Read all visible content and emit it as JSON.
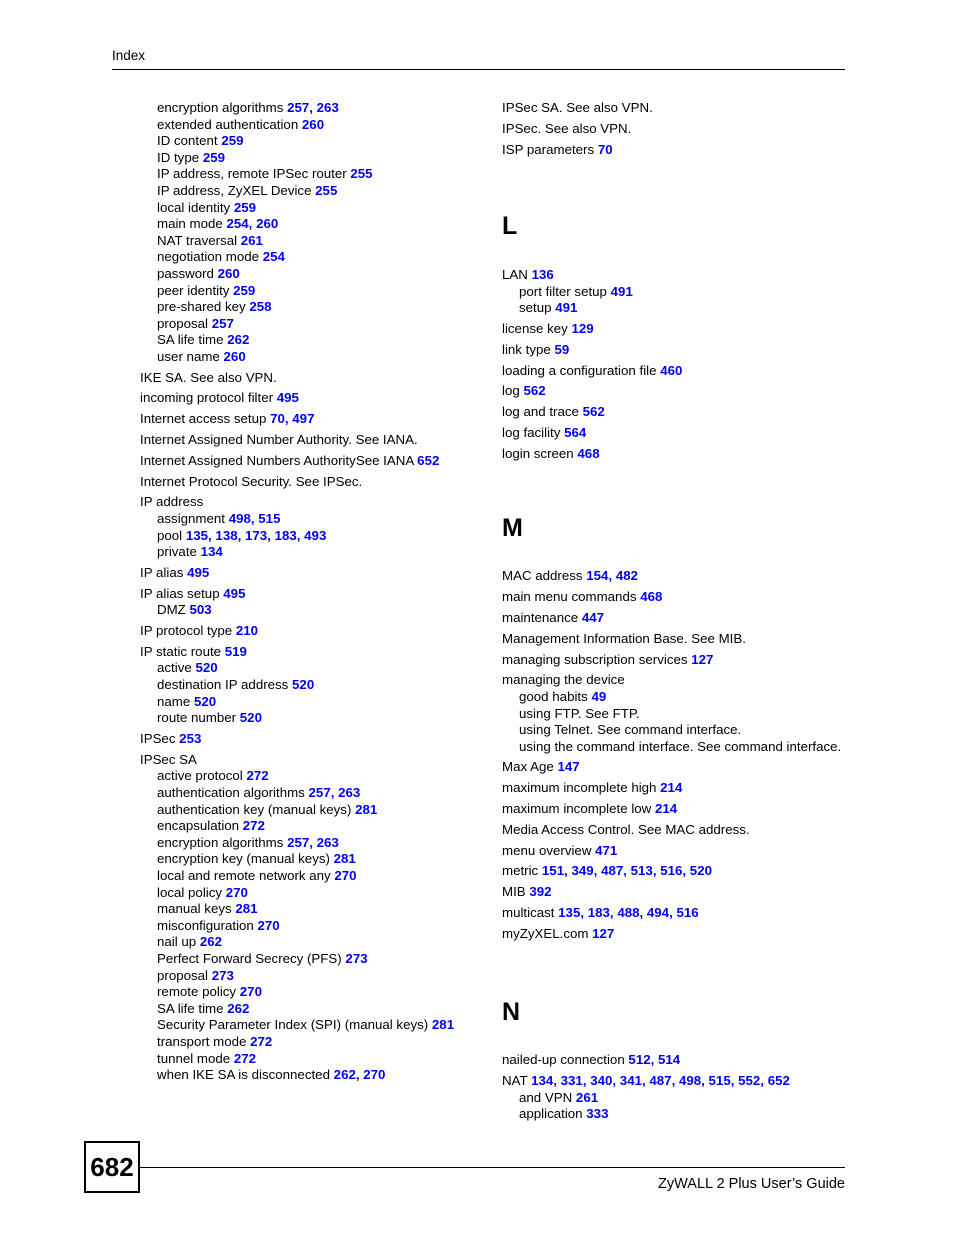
{
  "header": {
    "title": "Index"
  },
  "footer": {
    "page_number": "682",
    "guide_title": "ZyWALL 2 Plus User’s Guide"
  },
  "colors": {
    "page_reference": "#0000F5",
    "text": "#000000",
    "background": "#FFFFFF"
  },
  "left_column": {
    "entries": [
      {
        "level": 1,
        "text": "encryption algorithms ",
        "pages": [
          "257",
          "263"
        ]
      },
      {
        "level": 1,
        "text": "extended authentication ",
        "pages": [
          "260"
        ]
      },
      {
        "level": 1,
        "text": "ID content ",
        "pages": [
          "259"
        ]
      },
      {
        "level": 1,
        "text": "ID type ",
        "pages": [
          "259"
        ]
      },
      {
        "level": 1,
        "text": "IP address, remote IPSec router ",
        "pages": [
          "255"
        ]
      },
      {
        "level": 1,
        "text": "IP address, ZyXEL Device ",
        "pages": [
          "255"
        ]
      },
      {
        "level": 1,
        "text": "local identity ",
        "pages": [
          "259"
        ]
      },
      {
        "level": 1,
        "text": "main mode ",
        "pages": [
          "254",
          "260"
        ]
      },
      {
        "level": 1,
        "text": "NAT traversal ",
        "pages": [
          "261"
        ]
      },
      {
        "level": 1,
        "text": "negotiation mode ",
        "pages": [
          "254"
        ]
      },
      {
        "level": 1,
        "text": "password ",
        "pages": [
          "260"
        ]
      },
      {
        "level": 1,
        "text": "peer identity ",
        "pages": [
          "259"
        ]
      },
      {
        "level": 1,
        "text": "pre-shared key ",
        "pages": [
          "258"
        ]
      },
      {
        "level": 1,
        "text": "proposal ",
        "pages": [
          "257"
        ]
      },
      {
        "level": 1,
        "text": "SA life time ",
        "pages": [
          "262"
        ]
      },
      {
        "level": 1,
        "text": "user name ",
        "pages": [
          "260"
        ]
      },
      {
        "level": 0,
        "text": "IKE SA. See also VPN.",
        "pages": []
      },
      {
        "level": 0,
        "text": "incoming protocol filter ",
        "pages": [
          "495"
        ]
      },
      {
        "level": 0,
        "text": "Internet access setup ",
        "pages": [
          "70",
          "497"
        ]
      },
      {
        "level": 0,
        "text": "Internet Assigned Number Authority. See IANA.",
        "pages": []
      },
      {
        "level": 0,
        "text": "Internet Assigned Numbers AuthoritySee IANA ",
        "pages": [
          "652"
        ]
      },
      {
        "level": 0,
        "text": "Internet Protocol Security. See IPSec.",
        "pages": []
      },
      {
        "level": 0,
        "text": "IP address",
        "pages": []
      },
      {
        "level": 1,
        "text": "assignment ",
        "pages": [
          "498",
          "515"
        ]
      },
      {
        "level": 1,
        "text": "pool ",
        "pages": [
          "135",
          "138",
          "173",
          "183",
          "493"
        ]
      },
      {
        "level": 1,
        "text": "private ",
        "pages": [
          "134"
        ]
      },
      {
        "level": 0,
        "text": "IP alias ",
        "pages": [
          "495"
        ]
      },
      {
        "level": 0,
        "text": "IP alias setup ",
        "pages": [
          "495"
        ]
      },
      {
        "level": 1,
        "text": "DMZ ",
        "pages": [
          "503"
        ]
      },
      {
        "level": 0,
        "text": "IP protocol type ",
        "pages": [
          "210"
        ]
      },
      {
        "level": 0,
        "text": "IP static route ",
        "pages": [
          "519"
        ]
      },
      {
        "level": 1,
        "text": "active ",
        "pages": [
          "520"
        ]
      },
      {
        "level": 1,
        "text": "destination IP address ",
        "pages": [
          "520"
        ]
      },
      {
        "level": 1,
        "text": "name ",
        "pages": [
          "520"
        ]
      },
      {
        "level": 1,
        "text": "route number ",
        "pages": [
          "520"
        ]
      },
      {
        "level": 0,
        "text": "IPSec ",
        "pages": [
          "253"
        ]
      },
      {
        "level": 0,
        "text": "IPSec SA",
        "pages": []
      },
      {
        "level": 1,
        "text": "active protocol ",
        "pages": [
          "272"
        ]
      },
      {
        "level": 1,
        "text": "authentication algorithms ",
        "pages": [
          "257",
          "263"
        ]
      },
      {
        "level": 1,
        "text": "authentication key (manual keys) ",
        "pages": [
          "281"
        ]
      },
      {
        "level": 1,
        "text": "encapsulation ",
        "pages": [
          "272"
        ]
      },
      {
        "level": 1,
        "text": "encryption algorithms ",
        "pages": [
          "257",
          "263"
        ]
      },
      {
        "level": 1,
        "text": "encryption key (manual keys) ",
        "pages": [
          "281"
        ]
      },
      {
        "level": 1,
        "text": "local and remote network any ",
        "pages": [
          "270"
        ]
      },
      {
        "level": 1,
        "text": "local policy ",
        "pages": [
          "270"
        ]
      },
      {
        "level": 1,
        "text": "manual keys ",
        "pages": [
          "281"
        ]
      },
      {
        "level": 1,
        "text": "misconfiguration ",
        "pages": [
          "270"
        ]
      },
      {
        "level": 1,
        "text": "nail up ",
        "pages": [
          "262"
        ]
      },
      {
        "level": 1,
        "text": "Perfect Forward Secrecy (PFS) ",
        "pages": [
          "273"
        ]
      },
      {
        "level": 1,
        "text": "proposal ",
        "pages": [
          "273"
        ]
      },
      {
        "level": 1,
        "text": "remote policy ",
        "pages": [
          "270"
        ]
      },
      {
        "level": 1,
        "text": "SA life time ",
        "pages": [
          "262"
        ]
      },
      {
        "level": 1,
        "text": "Security Parameter Index (SPI) (manual keys) ",
        "pages": [
          "281"
        ]
      },
      {
        "level": 1,
        "text": "transport mode ",
        "pages": [
          "272"
        ]
      },
      {
        "level": 1,
        "text": "tunnel mode ",
        "pages": [
          "272"
        ]
      },
      {
        "level": 1,
        "text": "when IKE SA is disconnected ",
        "pages": [
          "262",
          "270"
        ]
      }
    ]
  },
  "right_column": {
    "top_entries": [
      {
        "level": 0,
        "text": "IPSec SA. See also VPN.",
        "pages": []
      },
      {
        "level": 0,
        "text": "IPSec. See also VPN.",
        "pages": []
      },
      {
        "level": 0,
        "text": "ISP parameters ",
        "pages": [
          "70"
        ]
      }
    ],
    "sections": [
      {
        "letter": "L",
        "entries": [
          {
            "level": 0,
            "text": "LAN ",
            "pages": [
              "136"
            ]
          },
          {
            "level": 1,
            "text": "port filter setup ",
            "pages": [
              "491"
            ]
          },
          {
            "level": 1,
            "text": "setup ",
            "pages": [
              "491"
            ]
          },
          {
            "level": 0,
            "text": "license key ",
            "pages": [
              "129"
            ]
          },
          {
            "level": 0,
            "text": "link type ",
            "pages": [
              "59"
            ]
          },
          {
            "level": 0,
            "text": "loading a configuration file ",
            "pages": [
              "460"
            ]
          },
          {
            "level": 0,
            "text": "log ",
            "pages": [
              "562"
            ]
          },
          {
            "level": 0,
            "text": "log and trace ",
            "pages": [
              "562"
            ]
          },
          {
            "level": 0,
            "text": "log facility ",
            "pages": [
              "564"
            ]
          },
          {
            "level": 0,
            "text": "login screen ",
            "pages": [
              "468"
            ]
          }
        ]
      },
      {
        "letter": "M",
        "entries": [
          {
            "level": 0,
            "text": "MAC address ",
            "pages": [
              "154",
              "482"
            ]
          },
          {
            "level": 0,
            "text": "main menu commands ",
            "pages": [
              "468"
            ]
          },
          {
            "level": 0,
            "text": "maintenance ",
            "pages": [
              "447"
            ]
          },
          {
            "level": 0,
            "text": "Management Information Base. See MIB.",
            "pages": []
          },
          {
            "level": 0,
            "text": "managing subscription services ",
            "pages": [
              "127"
            ]
          },
          {
            "level": 0,
            "text": "managing the device",
            "pages": []
          },
          {
            "level": 1,
            "text": "good habits ",
            "pages": [
              "49"
            ]
          },
          {
            "level": 1,
            "text": "using FTP. See FTP.",
            "pages": []
          },
          {
            "level": 1,
            "text": "using Telnet. See command interface.",
            "pages": []
          },
          {
            "level": 1,
            "text": "using the command interface. See command interface.",
            "pages": []
          },
          {
            "level": 0,
            "text": "Max Age ",
            "pages": [
              "147"
            ]
          },
          {
            "level": 0,
            "text": "maximum incomplete high ",
            "pages": [
              "214"
            ]
          },
          {
            "level": 0,
            "text": "maximum incomplete low ",
            "pages": [
              "214"
            ]
          },
          {
            "level": 0,
            "text": "Media Access Control. See MAC address.",
            "pages": []
          },
          {
            "level": 0,
            "text": "menu overview ",
            "pages": [
              "471"
            ]
          },
          {
            "level": 0,
            "text": "metric ",
            "pages": [
              "151",
              "349",
              "487",
              "513",
              "516",
              "520"
            ]
          },
          {
            "level": 0,
            "text": "MIB ",
            "pages": [
              "392"
            ]
          },
          {
            "level": 0,
            "text": "multicast ",
            "pages": [
              "135",
              "183",
              "488",
              "494",
              "516"
            ]
          },
          {
            "level": 0,
            "text": "myZyXEL.com ",
            "pages": [
              "127"
            ]
          }
        ]
      },
      {
        "letter": "N",
        "entries": [
          {
            "level": 0,
            "text": "nailed-up connection ",
            "pages": [
              "512",
              "514"
            ]
          },
          {
            "level": 0,
            "text": "NAT ",
            "pages": [
              "134",
              "331",
              "340",
              "341",
              "487",
              "498",
              "515",
              "552",
              "652"
            ]
          },
          {
            "level": 1,
            "text": "and VPN ",
            "pages": [
              "261"
            ]
          },
          {
            "level": 1,
            "text": "application ",
            "pages": [
              "333"
            ]
          }
        ]
      }
    ]
  }
}
